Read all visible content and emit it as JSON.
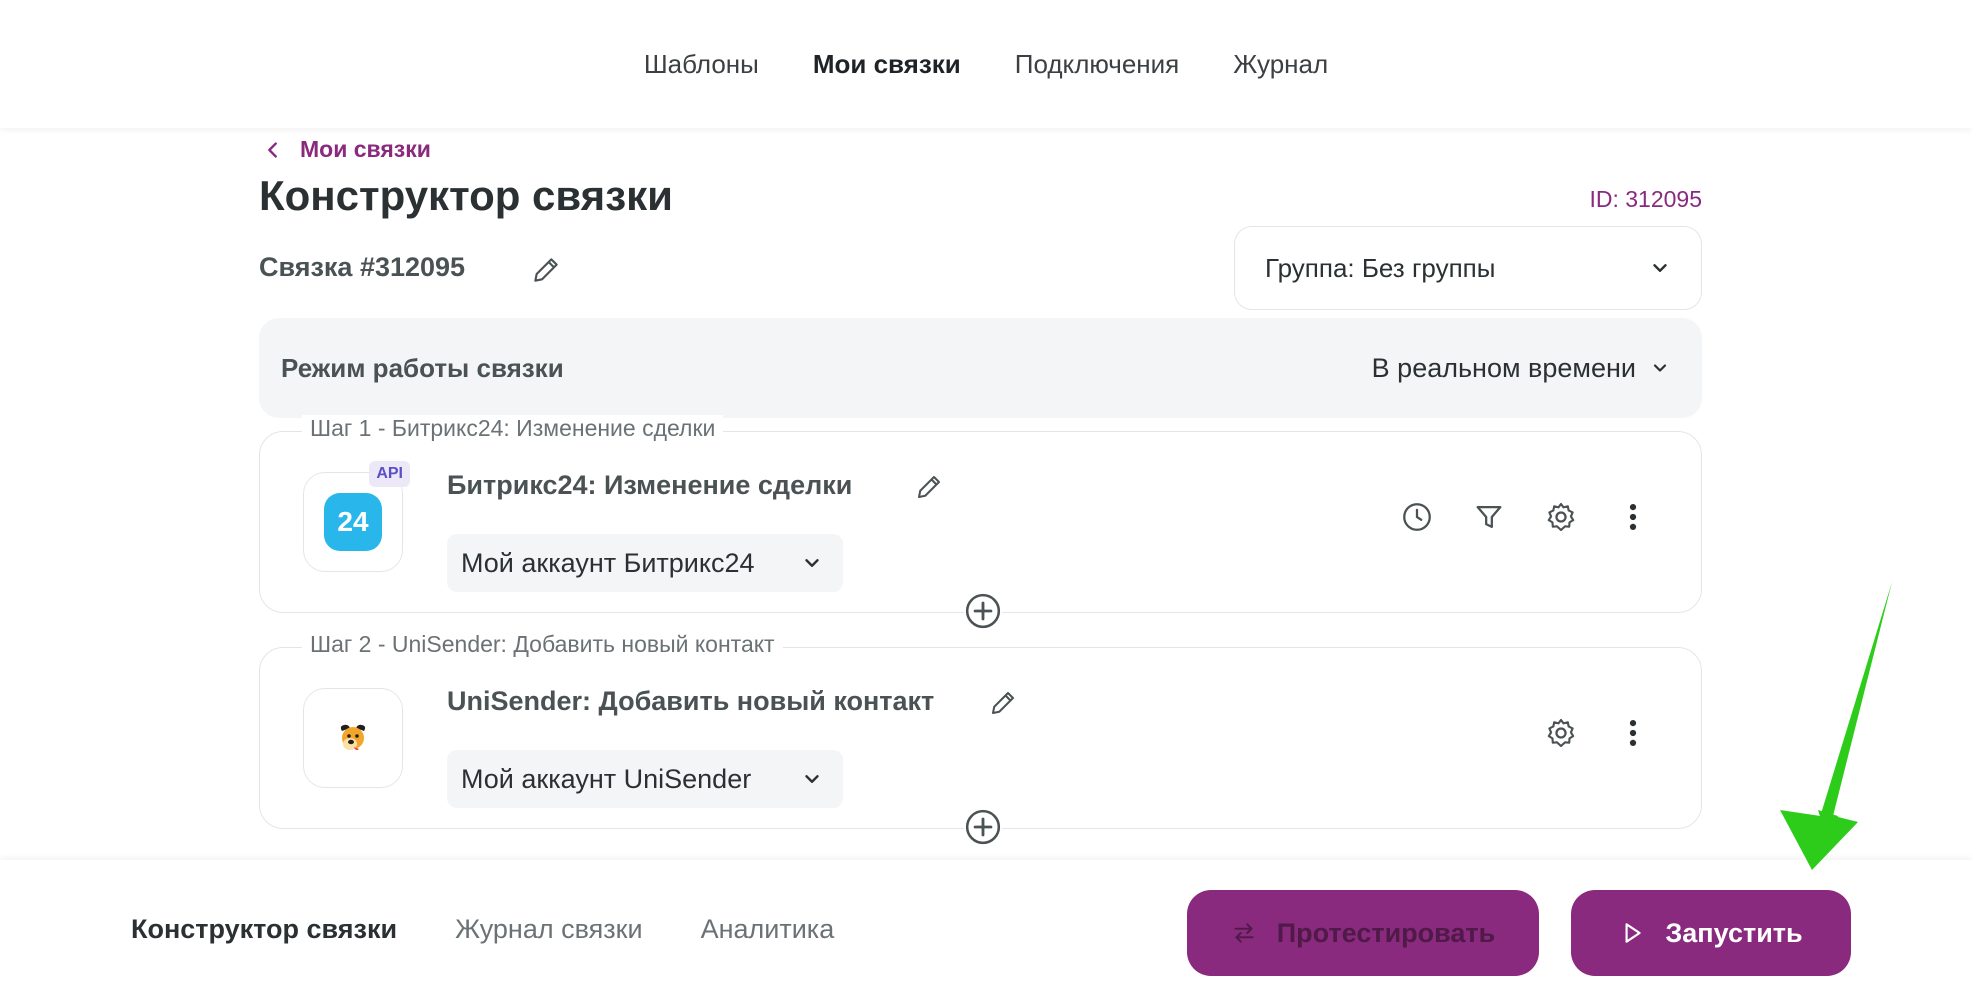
{
  "topnav": {
    "items": [
      {
        "label": "Шаблоны"
      },
      {
        "label": "Мои связки"
      },
      {
        "label": "Подключения"
      },
      {
        "label": "Журнал"
      }
    ]
  },
  "breadcrumb": {
    "label": "Мои связки"
  },
  "page": {
    "title": "Конструктор связки",
    "id_label": "ID: 312095",
    "link_name": "Связка #312095",
    "group_select": "Группа: Без группы"
  },
  "mode": {
    "label": "Режим работы связки",
    "value": "В реальном времени"
  },
  "steps": [
    {
      "legend": "Шаг 1 - Битрикс24: Изменение сделки",
      "title": "Битрикс24: Изменение сделки",
      "account": "Мой аккаунт Битрикс24",
      "logo_text": "24",
      "badge": "API",
      "icon": "bitrix24-icon"
    },
    {
      "legend": "Шаг 2 - UniSender: Добавить новый контакт",
      "title": "UniSender: Добавить новый контакт",
      "account": "Мой аккаунт UniSender",
      "icon": "unisender-icon"
    }
  ],
  "bottom": {
    "tabs": [
      {
        "label": "Конструктор связки"
      },
      {
        "label": "Журнал связки"
      },
      {
        "label": "Аналитика"
      }
    ],
    "test_button": "Протестировать",
    "run_button": "Запустить"
  },
  "colors": {
    "accent": "#8a2a7e",
    "arrow": "#2ecc1a",
    "bitrix": "#29b6ea"
  }
}
